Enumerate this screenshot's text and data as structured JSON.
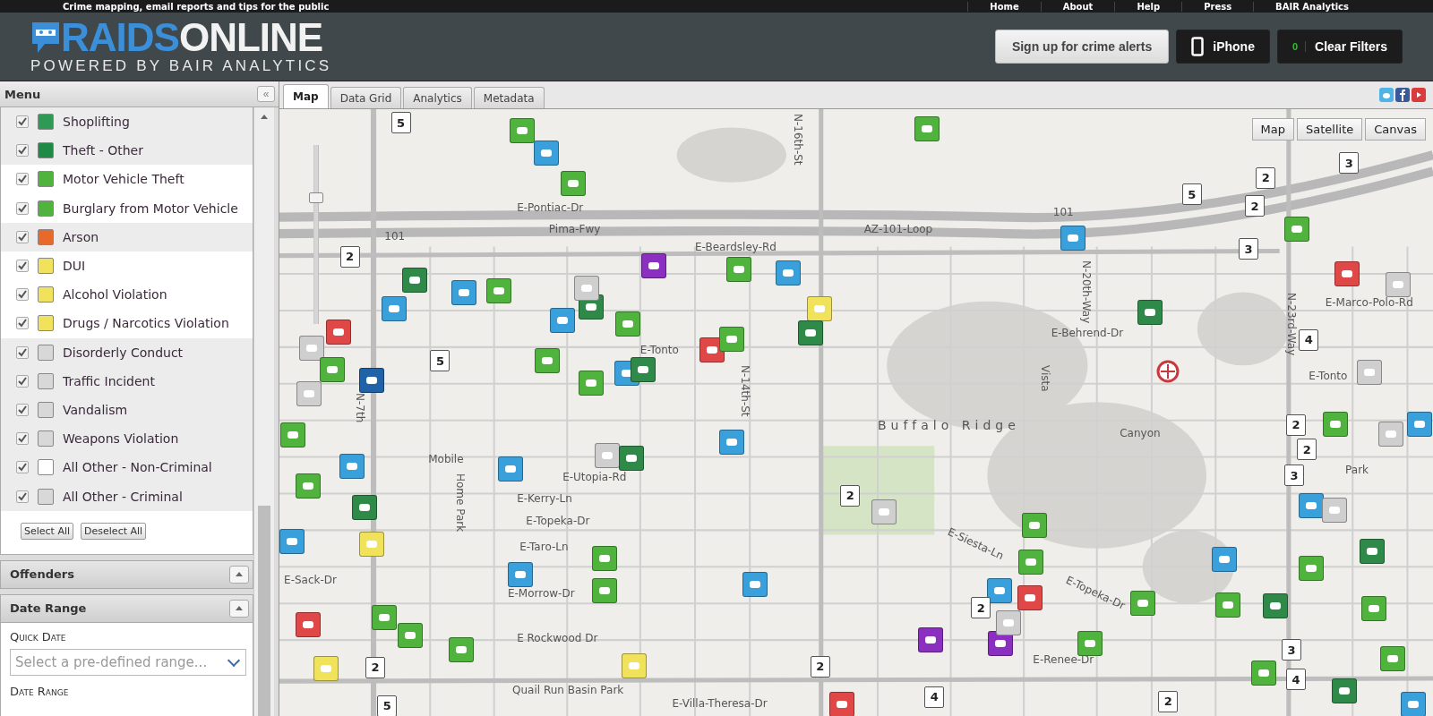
{
  "top_bar": {
    "tagline": "Crime mapping, email reports and tips for the public",
    "links": [
      "Home",
      "About",
      "Help",
      "Press",
      "BAIR Analytics"
    ]
  },
  "header": {
    "logo": {
      "part_1": "RAIDS",
      "part_2": "ONLINE",
      "tagline": "POWERED BY BAIR ANALYTICS"
    },
    "alerts_button": "Sign up for crime alerts",
    "iphone_button": "iPhone",
    "filter_count": "0",
    "clear_button": "Clear Filters"
  },
  "sidebar": {
    "menu": {
      "title": "Menu",
      "collapse": "«",
      "items": [
        {
          "label": "Shoplifting",
          "checked": true,
          "shaded": true,
          "color": "#2e9a55"
        },
        {
          "label": "Theft - Other",
          "checked": true,
          "shaded": true,
          "color": "#1f8a45"
        },
        {
          "label": "Motor Vehicle Theft",
          "checked": true,
          "shaded": false,
          "color": "#4fb33d"
        },
        {
          "label": "Burglary from Motor Vehicle",
          "checked": true,
          "shaded": false,
          "color": "#4fb33d"
        },
        {
          "label": "Arson",
          "checked": true,
          "shaded": true,
          "color": "#e8692a"
        },
        {
          "label": "DUI",
          "checked": true,
          "shaded": false,
          "color": "#f0e25a"
        },
        {
          "label": "Alcohol Violation",
          "checked": true,
          "shaded": false,
          "color": "#f0e25a"
        },
        {
          "label": "Drugs / Narcotics Violation",
          "checked": true,
          "shaded": false,
          "color": "#f0e25a"
        },
        {
          "label": "Disorderly Conduct",
          "checked": true,
          "shaded": true,
          "color": "#d8d8d8"
        },
        {
          "label": "Traffic Incident",
          "checked": true,
          "shaded": true,
          "color": "#d8d8d8"
        },
        {
          "label": "Vandalism",
          "checked": true,
          "shaded": true,
          "color": "#d8d8d8"
        },
        {
          "label": "Weapons Violation",
          "checked": true,
          "shaded": true,
          "color": "#d8d8d8"
        },
        {
          "label": "All Other - Non-Criminal",
          "checked": true,
          "shaded": true,
          "color": "#ffffff"
        },
        {
          "label": "All Other - Criminal",
          "checked": true,
          "shaded": true,
          "color": "#d8d8d8"
        }
      ],
      "select_all": "Select All",
      "deselect_all": "Deselect All"
    },
    "offenders": {
      "title": "Offenders"
    },
    "date_range": {
      "title": "Date Range",
      "quick_date_label": "Quick Date",
      "quick_date": {
        "placeholder": "Select a pre-defined range..."
      },
      "range_label": "Date Range"
    }
  },
  "tabs": [
    {
      "label": "Map",
      "selected": true
    },
    {
      "label": "Data Grid",
      "selected": false
    },
    {
      "label": "Analytics",
      "selected": false
    },
    {
      "label": "Metadata",
      "selected": false
    }
  ],
  "map": {
    "type_buttons": [
      "Map",
      "Satellite",
      "Canvas"
    ],
    "zoom": {
      "level": 0.72
    },
    "street_labels": [
      "E-Pontiac-Dr",
      "Pima-Fwy",
      "AZ-101-Loop",
      "E-Beardsley-Rd",
      "E-Marco-Polo-Rd",
      "E-Behrend-Dr",
      "E-Tonto",
      "Buffalo Ridge",
      "Canyon",
      "E-Utopia-Rd",
      "Mobile",
      "E-Kerry-Ln",
      "E-Topeka-Dr",
      "E-Taro-Ln",
      "E-Sack-Dr",
      "E-Morrow-Dr",
      "E Rockwood Dr",
      "E-Siesta-Ln",
      "E-Topeka-Dr",
      "E-Renee-Dr",
      "Quail Run Basin Park",
      "E-Villa-Theresa-Dr",
      "N-7th",
      "N-14th-St",
      "N-16th-St",
      "N-20th-Way",
      "N-23rd-Way",
      "Vista",
      "Home Park",
      "Park",
      "E-Tonto",
      "101",
      "101"
    ],
    "clusters": [
      "5",
      "2",
      "5",
      "2",
      "2",
      "2",
      "5",
      "3",
      "3",
      "4",
      "2",
      "2",
      "3",
      "2",
      "2",
      "2",
      "4",
      "3",
      "4",
      "5",
      "2"
    ],
    "pins": [
      {
        "color": "#4fb33d"
      },
      {
        "color": "#3aa0db"
      },
      {
        "color": "#4fb33d"
      },
      {
        "color": "#4fb33d"
      },
      {
        "color": "#3aa0db"
      },
      {
        "color": "#4fb33d"
      },
      {
        "color": "#e04848"
      },
      {
        "color": "#cfcfcf"
      },
      {
        "color": "#2f8a4a"
      },
      {
        "color": "#cfcfcf"
      },
      {
        "color": "#3aa0db"
      },
      {
        "color": "#cfcfcf"
      },
      {
        "color": "#4fb33d"
      },
      {
        "color": "#8a2fc0"
      },
      {
        "color": "#4fb33d"
      },
      {
        "color": "#3aa0db"
      },
      {
        "color": "#f0e25a"
      },
      {
        "color": "#2f8a4a"
      },
      {
        "color": "#e04848"
      },
      {
        "color": "#4fb33d"
      },
      {
        "color": "#4fb33d"
      },
      {
        "color": "#2f8a4a"
      },
      {
        "color": "#3aa0db"
      },
      {
        "color": "#cfcfcf"
      },
      {
        "color": "#4fb33d"
      },
      {
        "color": "#3aa0db"
      },
      {
        "color": "#2f8a4a"
      },
      {
        "color": "#3aa0db"
      },
      {
        "color": "#e04848"
      },
      {
        "color": "#cfcfcf"
      },
      {
        "color": "#4fb33d"
      },
      {
        "color": "#1f62a8"
      },
      {
        "color": "#cfcfcf"
      },
      {
        "color": "#4fb33d"
      },
      {
        "color": "#4fb33d"
      },
      {
        "color": "#3aa0db"
      },
      {
        "color": "#2f8a4a"
      },
      {
        "color": "#4fb33d"
      },
      {
        "color": "#3aa0db"
      },
      {
        "color": "#4fb33d"
      },
      {
        "color": "#3aa0db"
      },
      {
        "color": "#cfcfcf"
      },
      {
        "color": "#2f8a4a"
      },
      {
        "color": "#3aa0db"
      },
      {
        "color": "#2f8a4a"
      },
      {
        "color": "#3aa0db"
      },
      {
        "color": "#f0e25a"
      },
      {
        "color": "#3aa0db"
      },
      {
        "color": "#4fb33d"
      },
      {
        "color": "#4fb33d"
      },
      {
        "color": "#3aa0db"
      },
      {
        "color": "#cfcfcf"
      },
      {
        "color": "#4fb33d"
      },
      {
        "color": "#4fb33d"
      },
      {
        "color": "#3aa0db"
      },
      {
        "color": "#e04848"
      },
      {
        "color": "#4fb33d"
      },
      {
        "color": "#3aa0db"
      },
      {
        "color": "#4fb33d"
      },
      {
        "color": "#2f8a4a"
      },
      {
        "color": "#4fb33d"
      },
      {
        "color": "#2f8a4a"
      },
      {
        "color": "#4fb33d"
      },
      {
        "color": "#3aa0db"
      },
      {
        "color": "#cfcfcf"
      },
      {
        "color": "#8a2fc0"
      },
      {
        "color": "#8a2fc0"
      },
      {
        "color": "#4fb33d"
      },
      {
        "color": "#e04848"
      },
      {
        "color": "#4fb33d"
      },
      {
        "color": "#4fb33d"
      },
      {
        "color": "#f0e25a"
      },
      {
        "color": "#f0e25a"
      },
      {
        "color": "#4fb33d"
      },
      {
        "color": "#2f8a4a"
      },
      {
        "color": "#4fb33d"
      },
      {
        "color": "#3aa0db"
      },
      {
        "color": "#e04848"
      },
      {
        "color": "#cfcfcf"
      },
      {
        "color": "#4fb33d"
      }
    ]
  }
}
